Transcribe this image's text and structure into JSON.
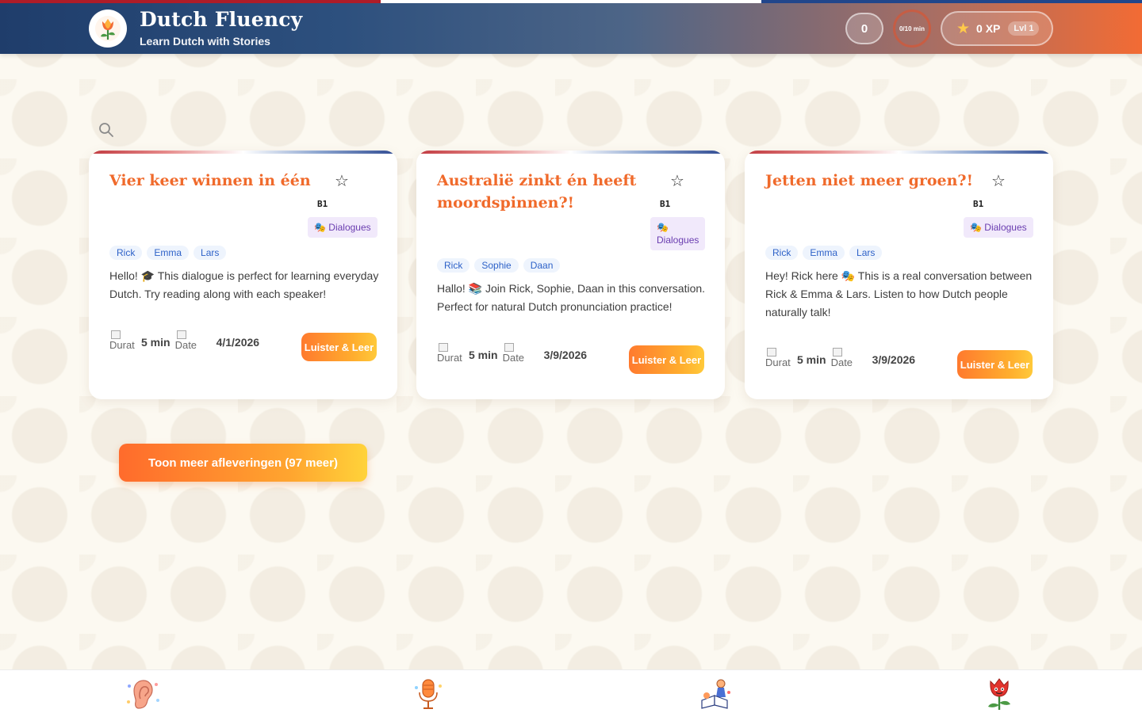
{
  "header": {
    "title": "Dutch Fluency",
    "subtitle": "Learn Dutch with Stories",
    "streak": "0",
    "timer": "0/10 min",
    "xp": "0 XP",
    "level": "Lvl 1"
  },
  "colors": {
    "accent_orange": "#f06a2b",
    "flag_red": "#ae1c28",
    "flag_white": "#ffffff",
    "flag_blue": "#21468b"
  },
  "icons": {
    "logo": "tulip-icon",
    "search": "search-icon",
    "favorite": "star-outline-icon",
    "xp": "star-icon",
    "nav": [
      "ear-icon",
      "microphone-icon",
      "reading-person-icon",
      "tulip-character-icon"
    ]
  },
  "cards": [
    {
      "title": "Vier keer winnen in één",
      "favorite": "☆",
      "level": "B1",
      "category": "🎭 Dialogues",
      "speakers": [
        "Rick",
        "Emma",
        "Lars"
      ],
      "description": "Hello! 🎓 This dialogue is perfect for learning everyday Dutch. Try reading along with each speaker!",
      "duration_alt": "Durat",
      "duration": "5 min",
      "date_alt": "Date",
      "date": "4/1/2026",
      "button": "Luister  & Leer"
    },
    {
      "title": "Australië zinkt én heeft moordspinnen?!",
      "favorite": "☆",
      "level": "B1",
      "category": "🎭 Dialogues",
      "speakers": [
        "Rick",
        "Sophie",
        "Daan"
      ],
      "description": "Hallo! 📚 Join Rick, Sophie, Daan in this conversation. Perfect for natural Dutch pronunciation practice!",
      "duration_alt": "Durat",
      "duration": "5 min",
      "date_alt": "Date",
      "date": "3/9/2026",
      "button": "Luister  & Leer"
    },
    {
      "title": "Jetten niet meer groen?!",
      "favorite": "☆",
      "level": "B1",
      "category": "🎭 Dialogues",
      "speakers": [
        "Rick",
        "Emma",
        "Lars"
      ],
      "description": "Hey! Rick here 🎭 This is a real conversation between Rick & Emma & Lars. Listen to how Dutch people naturally talk!",
      "duration_alt": "Durat",
      "duration": "5 min",
      "date_alt": "Date",
      "date": "3/9/2026",
      "button": "Luister  & Leer"
    }
  ],
  "show_more": "Toon meer afleveringen (97 meer)"
}
